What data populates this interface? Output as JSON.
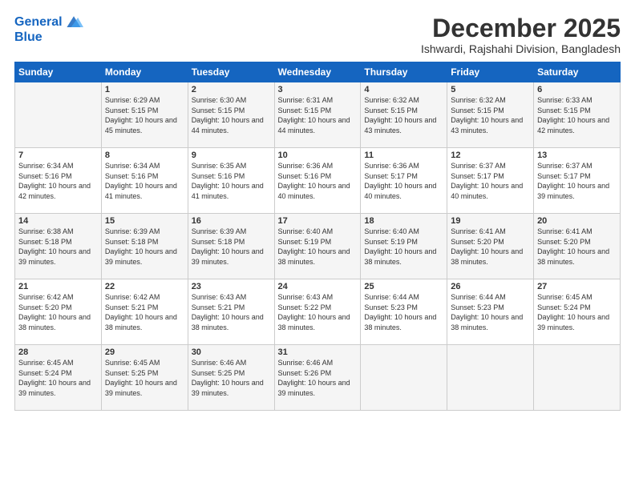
{
  "logo": {
    "line1": "General",
    "line2": "Blue"
  },
  "title": "December 2025",
  "subtitle": "Ishwardi, Rajshahi Division, Bangladesh",
  "days": [
    "Sunday",
    "Monday",
    "Tuesday",
    "Wednesday",
    "Thursday",
    "Friday",
    "Saturday"
  ],
  "weeks": [
    [
      {
        "num": "",
        "sunrise": "",
        "sunset": "",
        "daylight": ""
      },
      {
        "num": "1",
        "sunrise": "Sunrise: 6:29 AM",
        "sunset": "Sunset: 5:15 PM",
        "daylight": "Daylight: 10 hours and 45 minutes."
      },
      {
        "num": "2",
        "sunrise": "Sunrise: 6:30 AM",
        "sunset": "Sunset: 5:15 PM",
        "daylight": "Daylight: 10 hours and 44 minutes."
      },
      {
        "num": "3",
        "sunrise": "Sunrise: 6:31 AM",
        "sunset": "Sunset: 5:15 PM",
        "daylight": "Daylight: 10 hours and 44 minutes."
      },
      {
        "num": "4",
        "sunrise": "Sunrise: 6:32 AM",
        "sunset": "Sunset: 5:15 PM",
        "daylight": "Daylight: 10 hours and 43 minutes."
      },
      {
        "num": "5",
        "sunrise": "Sunrise: 6:32 AM",
        "sunset": "Sunset: 5:15 PM",
        "daylight": "Daylight: 10 hours and 43 minutes."
      },
      {
        "num": "6",
        "sunrise": "Sunrise: 6:33 AM",
        "sunset": "Sunset: 5:15 PM",
        "daylight": "Daylight: 10 hours and 42 minutes."
      }
    ],
    [
      {
        "num": "7",
        "sunrise": "Sunrise: 6:34 AM",
        "sunset": "Sunset: 5:16 PM",
        "daylight": "Daylight: 10 hours and 42 minutes."
      },
      {
        "num": "8",
        "sunrise": "Sunrise: 6:34 AM",
        "sunset": "Sunset: 5:16 PM",
        "daylight": "Daylight: 10 hours and 41 minutes."
      },
      {
        "num": "9",
        "sunrise": "Sunrise: 6:35 AM",
        "sunset": "Sunset: 5:16 PM",
        "daylight": "Daylight: 10 hours and 41 minutes."
      },
      {
        "num": "10",
        "sunrise": "Sunrise: 6:36 AM",
        "sunset": "Sunset: 5:16 PM",
        "daylight": "Daylight: 10 hours and 40 minutes."
      },
      {
        "num": "11",
        "sunrise": "Sunrise: 6:36 AM",
        "sunset": "Sunset: 5:17 PM",
        "daylight": "Daylight: 10 hours and 40 minutes."
      },
      {
        "num": "12",
        "sunrise": "Sunrise: 6:37 AM",
        "sunset": "Sunset: 5:17 PM",
        "daylight": "Daylight: 10 hours and 40 minutes."
      },
      {
        "num": "13",
        "sunrise": "Sunrise: 6:37 AM",
        "sunset": "Sunset: 5:17 PM",
        "daylight": "Daylight: 10 hours and 39 minutes."
      }
    ],
    [
      {
        "num": "14",
        "sunrise": "Sunrise: 6:38 AM",
        "sunset": "Sunset: 5:18 PM",
        "daylight": "Daylight: 10 hours and 39 minutes."
      },
      {
        "num": "15",
        "sunrise": "Sunrise: 6:39 AM",
        "sunset": "Sunset: 5:18 PM",
        "daylight": "Daylight: 10 hours and 39 minutes."
      },
      {
        "num": "16",
        "sunrise": "Sunrise: 6:39 AM",
        "sunset": "Sunset: 5:18 PM",
        "daylight": "Daylight: 10 hours and 39 minutes."
      },
      {
        "num": "17",
        "sunrise": "Sunrise: 6:40 AM",
        "sunset": "Sunset: 5:19 PM",
        "daylight": "Daylight: 10 hours and 38 minutes."
      },
      {
        "num": "18",
        "sunrise": "Sunrise: 6:40 AM",
        "sunset": "Sunset: 5:19 PM",
        "daylight": "Daylight: 10 hours and 38 minutes."
      },
      {
        "num": "19",
        "sunrise": "Sunrise: 6:41 AM",
        "sunset": "Sunset: 5:20 PM",
        "daylight": "Daylight: 10 hours and 38 minutes."
      },
      {
        "num": "20",
        "sunrise": "Sunrise: 6:41 AM",
        "sunset": "Sunset: 5:20 PM",
        "daylight": "Daylight: 10 hours and 38 minutes."
      }
    ],
    [
      {
        "num": "21",
        "sunrise": "Sunrise: 6:42 AM",
        "sunset": "Sunset: 5:20 PM",
        "daylight": "Daylight: 10 hours and 38 minutes."
      },
      {
        "num": "22",
        "sunrise": "Sunrise: 6:42 AM",
        "sunset": "Sunset: 5:21 PM",
        "daylight": "Daylight: 10 hours and 38 minutes."
      },
      {
        "num": "23",
        "sunrise": "Sunrise: 6:43 AM",
        "sunset": "Sunset: 5:21 PM",
        "daylight": "Daylight: 10 hours and 38 minutes."
      },
      {
        "num": "24",
        "sunrise": "Sunrise: 6:43 AM",
        "sunset": "Sunset: 5:22 PM",
        "daylight": "Daylight: 10 hours and 38 minutes."
      },
      {
        "num": "25",
        "sunrise": "Sunrise: 6:44 AM",
        "sunset": "Sunset: 5:23 PM",
        "daylight": "Daylight: 10 hours and 38 minutes."
      },
      {
        "num": "26",
        "sunrise": "Sunrise: 6:44 AM",
        "sunset": "Sunset: 5:23 PM",
        "daylight": "Daylight: 10 hours and 38 minutes."
      },
      {
        "num": "27",
        "sunrise": "Sunrise: 6:45 AM",
        "sunset": "Sunset: 5:24 PM",
        "daylight": "Daylight: 10 hours and 39 minutes."
      }
    ],
    [
      {
        "num": "28",
        "sunrise": "Sunrise: 6:45 AM",
        "sunset": "Sunset: 5:24 PM",
        "daylight": "Daylight: 10 hours and 39 minutes."
      },
      {
        "num": "29",
        "sunrise": "Sunrise: 6:45 AM",
        "sunset": "Sunset: 5:25 PM",
        "daylight": "Daylight: 10 hours and 39 minutes."
      },
      {
        "num": "30",
        "sunrise": "Sunrise: 6:46 AM",
        "sunset": "Sunset: 5:25 PM",
        "daylight": "Daylight: 10 hours and 39 minutes."
      },
      {
        "num": "31",
        "sunrise": "Sunrise: 6:46 AM",
        "sunset": "Sunset: 5:26 PM",
        "daylight": "Daylight: 10 hours and 39 minutes."
      },
      {
        "num": "",
        "sunrise": "",
        "sunset": "",
        "daylight": ""
      },
      {
        "num": "",
        "sunrise": "",
        "sunset": "",
        "daylight": ""
      },
      {
        "num": "",
        "sunrise": "",
        "sunset": "",
        "daylight": ""
      }
    ]
  ]
}
